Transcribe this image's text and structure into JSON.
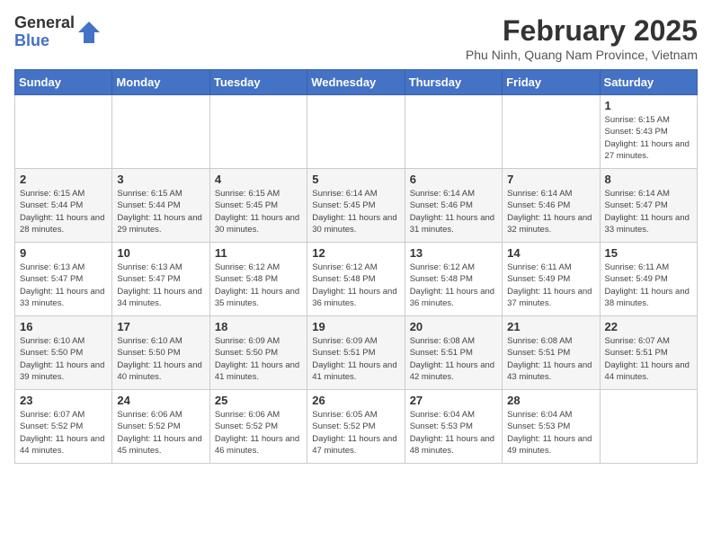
{
  "logo": {
    "general": "General",
    "blue": "Blue"
  },
  "title": "February 2025",
  "subtitle": "Phu Ninh, Quang Nam Province, Vietnam",
  "days_of_week": [
    "Sunday",
    "Monday",
    "Tuesday",
    "Wednesday",
    "Thursday",
    "Friday",
    "Saturday"
  ],
  "weeks": [
    [
      {
        "num": "",
        "info": ""
      },
      {
        "num": "",
        "info": ""
      },
      {
        "num": "",
        "info": ""
      },
      {
        "num": "",
        "info": ""
      },
      {
        "num": "",
        "info": ""
      },
      {
        "num": "",
        "info": ""
      },
      {
        "num": "1",
        "info": "Sunrise: 6:15 AM\nSunset: 5:43 PM\nDaylight: 11 hours and 27 minutes."
      }
    ],
    [
      {
        "num": "2",
        "info": "Sunrise: 6:15 AM\nSunset: 5:44 PM\nDaylight: 11 hours and 28 minutes."
      },
      {
        "num": "3",
        "info": "Sunrise: 6:15 AM\nSunset: 5:44 PM\nDaylight: 11 hours and 29 minutes."
      },
      {
        "num": "4",
        "info": "Sunrise: 6:15 AM\nSunset: 5:45 PM\nDaylight: 11 hours and 30 minutes."
      },
      {
        "num": "5",
        "info": "Sunrise: 6:14 AM\nSunset: 5:45 PM\nDaylight: 11 hours and 30 minutes."
      },
      {
        "num": "6",
        "info": "Sunrise: 6:14 AM\nSunset: 5:46 PM\nDaylight: 11 hours and 31 minutes."
      },
      {
        "num": "7",
        "info": "Sunrise: 6:14 AM\nSunset: 5:46 PM\nDaylight: 11 hours and 32 minutes."
      },
      {
        "num": "8",
        "info": "Sunrise: 6:14 AM\nSunset: 5:47 PM\nDaylight: 11 hours and 33 minutes."
      }
    ],
    [
      {
        "num": "9",
        "info": "Sunrise: 6:13 AM\nSunset: 5:47 PM\nDaylight: 11 hours and 33 minutes."
      },
      {
        "num": "10",
        "info": "Sunrise: 6:13 AM\nSunset: 5:47 PM\nDaylight: 11 hours and 34 minutes."
      },
      {
        "num": "11",
        "info": "Sunrise: 6:12 AM\nSunset: 5:48 PM\nDaylight: 11 hours and 35 minutes."
      },
      {
        "num": "12",
        "info": "Sunrise: 6:12 AM\nSunset: 5:48 PM\nDaylight: 11 hours and 36 minutes."
      },
      {
        "num": "13",
        "info": "Sunrise: 6:12 AM\nSunset: 5:48 PM\nDaylight: 11 hours and 36 minutes."
      },
      {
        "num": "14",
        "info": "Sunrise: 6:11 AM\nSunset: 5:49 PM\nDaylight: 11 hours and 37 minutes."
      },
      {
        "num": "15",
        "info": "Sunrise: 6:11 AM\nSunset: 5:49 PM\nDaylight: 11 hours and 38 minutes."
      }
    ],
    [
      {
        "num": "16",
        "info": "Sunrise: 6:10 AM\nSunset: 5:50 PM\nDaylight: 11 hours and 39 minutes."
      },
      {
        "num": "17",
        "info": "Sunrise: 6:10 AM\nSunset: 5:50 PM\nDaylight: 11 hours and 40 minutes."
      },
      {
        "num": "18",
        "info": "Sunrise: 6:09 AM\nSunset: 5:50 PM\nDaylight: 11 hours and 41 minutes."
      },
      {
        "num": "19",
        "info": "Sunrise: 6:09 AM\nSunset: 5:51 PM\nDaylight: 11 hours and 41 minutes."
      },
      {
        "num": "20",
        "info": "Sunrise: 6:08 AM\nSunset: 5:51 PM\nDaylight: 11 hours and 42 minutes."
      },
      {
        "num": "21",
        "info": "Sunrise: 6:08 AM\nSunset: 5:51 PM\nDaylight: 11 hours and 43 minutes."
      },
      {
        "num": "22",
        "info": "Sunrise: 6:07 AM\nSunset: 5:51 PM\nDaylight: 11 hours and 44 minutes."
      }
    ],
    [
      {
        "num": "23",
        "info": "Sunrise: 6:07 AM\nSunset: 5:52 PM\nDaylight: 11 hours and 44 minutes."
      },
      {
        "num": "24",
        "info": "Sunrise: 6:06 AM\nSunset: 5:52 PM\nDaylight: 11 hours and 45 minutes."
      },
      {
        "num": "25",
        "info": "Sunrise: 6:06 AM\nSunset: 5:52 PM\nDaylight: 11 hours and 46 minutes."
      },
      {
        "num": "26",
        "info": "Sunrise: 6:05 AM\nSunset: 5:52 PM\nDaylight: 11 hours and 47 minutes."
      },
      {
        "num": "27",
        "info": "Sunrise: 6:04 AM\nSunset: 5:53 PM\nDaylight: 11 hours and 48 minutes."
      },
      {
        "num": "28",
        "info": "Sunrise: 6:04 AM\nSunset: 5:53 PM\nDaylight: 11 hours and 49 minutes."
      },
      {
        "num": "",
        "info": ""
      }
    ]
  ]
}
